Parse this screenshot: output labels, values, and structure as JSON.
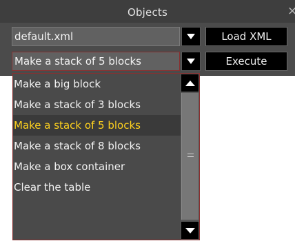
{
  "window": {
    "title": "Objects",
    "close_glyph": "×"
  },
  "controls": {
    "file_value": "default.xml",
    "load_label": "Load XML",
    "select_value": "Make a stack of 5 blocks",
    "execute_label": "Execute"
  },
  "dropdown": {
    "items": [
      {
        "label": "Make a big block"
      },
      {
        "label": "Make a stack of 3 blocks"
      },
      {
        "label": "Make a stack of 5 blocks"
      },
      {
        "label": "Make a stack of 8 blocks"
      },
      {
        "label": "Make a box container"
      },
      {
        "label": "Clear the table"
      }
    ],
    "selected_index": 2
  },
  "icons": {
    "close": "close-icon",
    "dropdown_arrow": "triangle-down-icon",
    "scroll_up": "triangle-up-icon",
    "scroll_down": "triangle-down-icon",
    "scroll_grip": "grip-icon"
  },
  "colors": {
    "panel": "#4b4b4b",
    "field": "#616161",
    "button": "#000000",
    "selected_text": "#ffd21e",
    "focus_border": "#8a2f2f"
  }
}
